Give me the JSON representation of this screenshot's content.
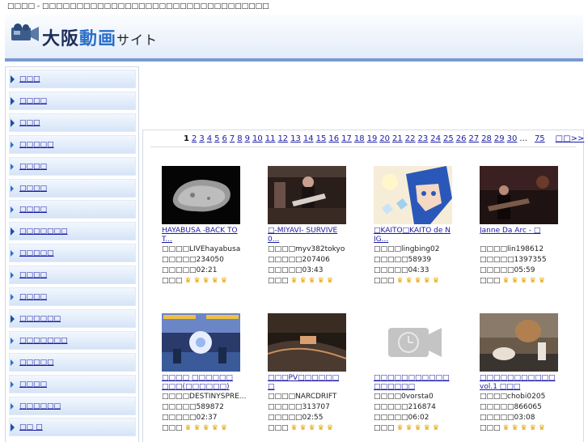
{
  "page_title": "□□□□ - □□□□□□□□□□□□□□□□□□□□□□□□□□□□□□□□□",
  "logo": {
    "part1": "大阪",
    "part2": "動画",
    "part3": "サイト"
  },
  "sidebar": {
    "items": [
      {
        "label": "□□□",
        "sub": false
      },
      {
        "label": "□□□□",
        "sub": false
      },
      {
        "label": "□□□",
        "sub": false
      },
      {
        "label": "□□□□□",
        "sub": true
      },
      {
        "label": "□□□□",
        "sub": true
      },
      {
        "label": "□□□□",
        "sub": true
      },
      {
        "label": "□□□□",
        "sub": true
      },
      {
        "label": "□□□□□□□",
        "sub": false
      },
      {
        "label": "□□□□□",
        "sub": true
      },
      {
        "label": "□□□□",
        "sub": true
      },
      {
        "label": "□□□□",
        "sub": true
      },
      {
        "label": "□□□□□□",
        "sub": false
      },
      {
        "label": "□□□□□□□",
        "sub": true
      },
      {
        "label": "□□□□□",
        "sub": true
      },
      {
        "label": "□□□□",
        "sub": true
      },
      {
        "label": "□□□□□□",
        "sub": true
      },
      {
        "label": "□□ □",
        "sub": false
      }
    ]
  },
  "pagination": {
    "current": "1",
    "pages": [
      "2",
      "3",
      "4",
      "5",
      "6",
      "7",
      "8",
      "9",
      "10",
      "11",
      "12",
      "13",
      "14",
      "15",
      "16",
      "17",
      "18",
      "19",
      "20",
      "21",
      "22",
      "23",
      "24",
      "25",
      "26",
      "27",
      "28",
      "29",
      "30"
    ],
    "ellipsis": "...",
    "last": "75",
    "next": "□□>>"
  },
  "videos": [
    {
      "title": "HAYABUSA -BACK TO T...",
      "user": "□□□□LIVEhayabusa",
      "views": "□□□□□234050",
      "length": "□□□□□02:21",
      "rating_label": "□□□",
      "stars": 5,
      "thumb": "asteroid"
    },
    {
      "title": "□-MIYAVI- SURVIVE 0...",
      "user": "□□□□myv382tokyo",
      "views": "□□□□□207406",
      "length": "□□□□□03:43",
      "rating_label": "□□□",
      "stars": 5,
      "thumb": "guitar"
    },
    {
      "title": "□KAITO□KAITO de NIG...",
      "user": "□□□□lingbing02",
      "views": "□□□□□58939",
      "length": "□□□□□04:33",
      "rating_label": "□□□",
      "stars": 5,
      "thumb": "anime"
    },
    {
      "title": "Janne Da Arc - □",
      "user": "□□□□lin198612",
      "views": "□□□□□1397355",
      "length": "□□□□□05:59",
      "rating_label": "□□□",
      "stars": 5,
      "thumb": "stage"
    },
    {
      "title": "□□□□ □□□□□□□□□(□□□□□□)",
      "user": "□□□□DESTINYSPRE...",
      "views": "□□□□□589872",
      "length": "□□□□□02:37",
      "rating_label": "□□□",
      "stars": 5,
      "thumb": "game"
    },
    {
      "title": "□□□PV□□□□□□□",
      "user": "□□□□NARCDRIFT",
      "views": "□□□□□313707",
      "length": "□□□□□02:55",
      "rating_label": "□□□",
      "stars": 5,
      "thumb": "drift"
    },
    {
      "title": "□□□□□□□□□□□ □□□□□□",
      "user": "□□□□0vorsta0",
      "views": "□□□□□216874",
      "length": "□□□□□06:02",
      "rating_label": "□□□",
      "stars": 5,
      "thumb": "placeholder"
    },
    {
      "title": "□□□□□□□□□□□vol.1 □□□",
      "user": "□□□□chobi0205",
      "views": "□□□□□866065",
      "length": "□□□□□03:08",
      "rating_label": "□□□",
      "stars": 5,
      "thumb": "cat"
    }
  ],
  "colors": {
    "link": "#1a1aa6",
    "header_rule": "#7a9ad0",
    "star": "#e8a400"
  }
}
